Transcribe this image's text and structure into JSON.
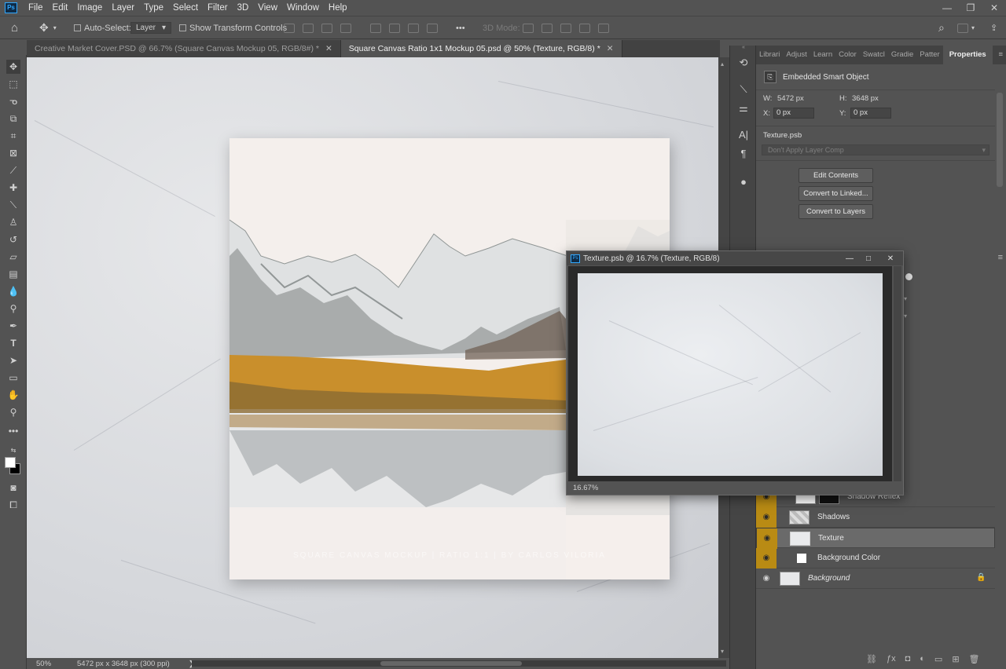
{
  "menu": {
    "logo": "Ps",
    "items": [
      "File",
      "Edit",
      "Image",
      "Layer",
      "Type",
      "Select",
      "Filter",
      "3D",
      "View",
      "Window",
      "Help"
    ]
  },
  "options": {
    "auto_select_label": "Auto-Select:",
    "auto_select_value": "Layer",
    "show_transform_label": "Show Transform Controls",
    "three_d_mode_label": "3D Mode:",
    "more": "•••"
  },
  "tabs": [
    {
      "label": "Creative Market Cover.PSD @ 66.7% (Square Canvas Mockup 05, RGB/8#) *",
      "active": false
    },
    {
      "label": "Square Canvas Ratio 1x1 Mockup 05.psd @ 50% (Texture, RGB/8) *",
      "active": true
    }
  ],
  "artwork": {
    "watermark": "SQUARE CANVAS MOCKUP | RATIO 1:1 | BY CARLOS VILORIA"
  },
  "status": {
    "zoom": "50%",
    "doc_info": "5472 px x 3648 px (300 ppi)"
  },
  "properties": {
    "tabs": [
      "Librari",
      "Adjust",
      "Learn",
      "Color",
      "Swatcl",
      "Gradie",
      "Patter",
      "Properties"
    ],
    "object_type": "Embedded Smart Object",
    "w_label": "W:",
    "w_value": "5472 px",
    "h_label": "H:",
    "h_value": "3648 px",
    "x_label": "X:",
    "x_value": "0 px",
    "y_label": "Y:",
    "y_value": "0 px",
    "file_name": "Texture.psb",
    "layer_comp": "Don't Apply Layer Comp",
    "buttons": [
      "Edit Contents",
      "Convert to Linked...",
      "Convert to Layers"
    ]
  },
  "texture_window": {
    "title": "Texture.psb @ 16.7% (Texture, RGB/8)",
    "zoom": "16.67%"
  },
  "layers": [
    {
      "name": "Shadow Reflex"
    },
    {
      "name": "Shadows"
    },
    {
      "name": "Texture"
    },
    {
      "name": "Background Color"
    },
    {
      "name": "Background"
    }
  ],
  "colors": {
    "eye_highlight": "#b98b14",
    "accent": "#31a8ff"
  }
}
